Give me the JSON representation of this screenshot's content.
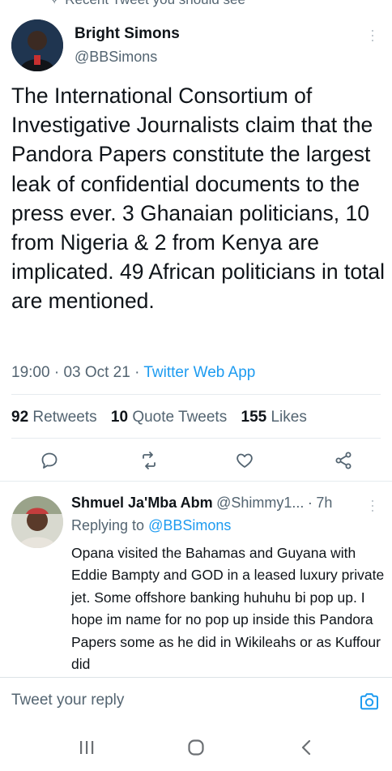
{
  "top_cut_text": "Recent Tweet you should see",
  "tweet": {
    "author_name": "Bright Simons",
    "author_handle": "@BBSimons",
    "text": "The International Consortium of Investigative Journalists claim that the Pandora Papers constitute the largest leak of confidential documents to the press ever. 3 Ghanaian politicians, 10 from Nigeria & 2 from Kenya are implicated. 49 African politicians in total are mentioned.",
    "time": "19:00",
    "date": "03 Oct 21",
    "client": "Twitter Web App",
    "retweets_count": "92",
    "retweets_label": "Retweets",
    "quotes_count": "10",
    "quotes_label": "Quote Tweets",
    "likes_count": "155",
    "likes_label": "Likes"
  },
  "reply": {
    "author_name": "Shmuel Ja'Mba Abm",
    "author_handle": "@Shimmy1...",
    "age": "7h",
    "replying_to_label": "Replying to",
    "replying_to_handle": "@BBSimons",
    "text": "Opana visited the Bahamas and Guyana with Eddie Bampty and GOD in a leased luxury private jet. Some offshore banking huhuhu bi pop up. I hope im name for no pop up inside this Pandora Papers some as he did in Wikileahs or as Kuffour did"
  },
  "composer": {
    "placeholder": "Tweet your reply"
  },
  "icons": {
    "reply": "reply-icon",
    "retweet": "retweet-icon",
    "like": "heart-icon",
    "share": "share-icon",
    "camera": "camera-icon",
    "recents": "recent-apps-icon",
    "home": "home-icon",
    "back": "back-icon"
  },
  "colors": {
    "accent": "#1d9bf0",
    "secondary_text": "#536471",
    "primary_text": "#0f1419"
  }
}
